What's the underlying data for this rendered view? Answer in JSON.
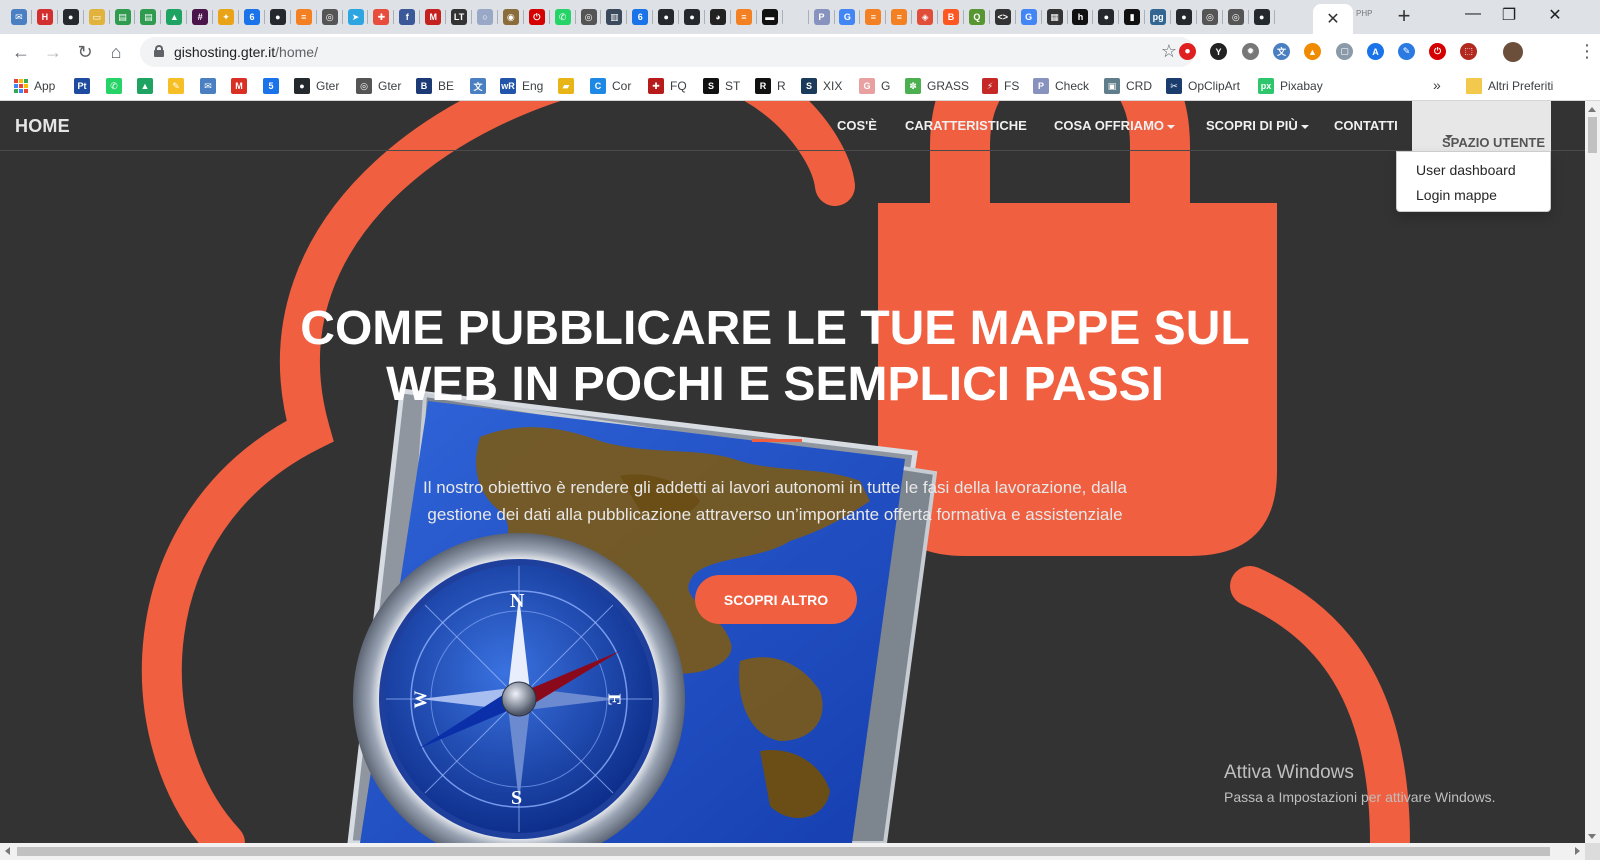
{
  "browser": {
    "url_host": "gishosting.gter.it",
    "url_path": "/home/",
    "tab_close": "✕",
    "new_tab": "+",
    "tab_after_text": "PHP",
    "window_controls": {
      "minimize": "—",
      "restore": "❐",
      "close": "✕"
    },
    "nav_icons": {
      "back": "←",
      "forward": "→",
      "reload": "↻",
      "home": "⌂",
      "star": "☆",
      "menu": "⋮"
    },
    "tab_favicons": [
      {
        "icon": "mail-icon",
        "color": "#4a7fc1",
        "glyph": "✉"
      },
      {
        "icon": "h-icon",
        "color": "#d32f2f",
        "glyph": "H"
      },
      {
        "icon": "github-icon",
        "color": "#24292e",
        "glyph": "●"
      },
      {
        "icon": "folder-icon",
        "color": "#e2b33c",
        "glyph": "▭"
      },
      {
        "icon": "sheet-icon",
        "color": "#2e9b4f",
        "glyph": "▤"
      },
      {
        "icon": "sheet-icon",
        "color": "#2e9b4f",
        "glyph": "▤"
      },
      {
        "icon": "drive-icon",
        "color": "#1ea362",
        "glyph": "▲"
      },
      {
        "icon": "slack-icon",
        "color": "#4a154b",
        "glyph": "#"
      },
      {
        "icon": "pinwheel-icon",
        "color": "#e8a317",
        "glyph": "✦"
      },
      {
        "icon": "calendar-icon",
        "color": "#1a73e8",
        "glyph": "6"
      },
      {
        "icon": "github-icon",
        "color": "#24292e",
        "glyph": "●"
      },
      {
        "icon": "stackoverflow-icon",
        "color": "#f48024",
        "glyph": "≡"
      },
      {
        "icon": "globe-icon",
        "color": "#555555",
        "glyph": "◎"
      },
      {
        "icon": "telegram-icon",
        "color": "#2ca5e0",
        "glyph": "➤"
      },
      {
        "icon": "puzzle-icon",
        "color": "#e74c3c",
        "glyph": "✚"
      },
      {
        "icon": "facebook-icon",
        "color": "#3b5998",
        "glyph": "f"
      },
      {
        "icon": "m-icon",
        "color": "#c5221f",
        "glyph": "M"
      },
      {
        "icon": "lt-icon",
        "color": "#333333",
        "glyph": "LT"
      },
      {
        "icon": "circle-icon",
        "color": "#9aa8c8",
        "glyph": "○"
      },
      {
        "icon": "eye-icon",
        "color": "#8a6d3b",
        "glyph": "◉"
      },
      {
        "icon": "power-icon",
        "color": "#d50000",
        "glyph": "⏻"
      },
      {
        "icon": "whatsapp-icon",
        "color": "#25d366",
        "glyph": "✆"
      },
      {
        "icon": "globe-icon",
        "color": "#555555",
        "glyph": "◎"
      },
      {
        "icon": "book-icon",
        "color": "#3a4a5c",
        "glyph": "▥"
      },
      {
        "icon": "calendar-icon",
        "color": "#1a73e8",
        "glyph": "6"
      },
      {
        "icon": "github-icon",
        "color": "#24292e",
        "glyph": "●"
      },
      {
        "icon": "github-icon",
        "color": "#24292e",
        "glyph": "●"
      },
      {
        "icon": "camera-icon",
        "color": "#222222",
        "glyph": "◕"
      },
      {
        "icon": "stackoverflow-icon",
        "color": "#f48024",
        "glyph": "≡"
      },
      {
        "icon": "monitor-icon",
        "color": "#111111",
        "glyph": "▬"
      },
      {
        "icon": "blank-icon",
        "color": "#dee1e6",
        "glyph": ""
      },
      {
        "icon": "php-icon",
        "color": "#8892bf",
        "glyph": "P"
      },
      {
        "icon": "google-icon",
        "color": "#4285f4",
        "glyph": "G"
      },
      {
        "icon": "stackoverflow-icon",
        "color": "#f48024",
        "glyph": "≡"
      },
      {
        "icon": "stackoverflow-icon",
        "color": "#f48024",
        "glyph": "≡"
      },
      {
        "icon": "paint-icon",
        "color": "#e04e39",
        "glyph": "◈"
      },
      {
        "icon": "blogger-icon",
        "color": "#ff5722",
        "glyph": "B"
      },
      {
        "icon": "qgis-icon",
        "color": "#589632",
        "glyph": "Q"
      },
      {
        "icon": "code-icon",
        "color": "#333333",
        "glyph": "<>"
      },
      {
        "icon": "google-icon",
        "color": "#4285f4",
        "glyph": "G"
      },
      {
        "icon": "barcode-icon",
        "color": "#333333",
        "glyph": "▦"
      },
      {
        "icon": "html-icon",
        "color": "#111111",
        "glyph": "h"
      },
      {
        "icon": "github-icon",
        "color": "#24292e",
        "glyph": "●"
      },
      {
        "icon": "bars-icon",
        "color": "#111111",
        "glyph": "▮"
      },
      {
        "icon": "pg-icon",
        "color": "#336791",
        "glyph": "pg"
      },
      {
        "icon": "github-icon",
        "color": "#24292e",
        "glyph": "●"
      },
      {
        "icon": "globe-icon",
        "color": "#555555",
        "glyph": "◎"
      },
      {
        "icon": "globe-icon",
        "color": "#555555",
        "glyph": "◎"
      },
      {
        "icon": "github-icon",
        "color": "#24292e",
        "glyph": "●"
      }
    ],
    "extensions": [
      {
        "icon": "stop-icon",
        "color": "#e02020",
        "glyph": "⏺"
      },
      {
        "icon": "y-icon",
        "color": "#222222",
        "glyph": "Y"
      },
      {
        "icon": "bug-icon",
        "color": "#777777",
        "glyph": "✹"
      },
      {
        "icon": "translate-icon",
        "color": "#4a7fc1",
        "glyph": "文"
      },
      {
        "icon": "vlc-icon",
        "color": "#f08a00",
        "glyph": "▲"
      },
      {
        "icon": "chat-icon",
        "color": "#8a9aa8",
        "glyph": "▢"
      },
      {
        "icon": "a-icon",
        "color": "#1a73e8",
        "glyph": "A"
      },
      {
        "icon": "feather-icon",
        "color": "#2a7ae2",
        "glyph": "✎"
      },
      {
        "icon": "power-icon",
        "color": "#d50000",
        "glyph": "⏻"
      },
      {
        "icon": "pdf-icon",
        "color": "#b22a1f",
        "glyph": "⬚"
      },
      {
        "icon": "avatar-icon",
        "color": "#6b4f3a",
        "glyph": ""
      }
    ]
  },
  "bookmarks": [
    {
      "icon": "apps-icon",
      "color": "#4285f4",
      "glyph": "",
      "label": "App"
    },
    {
      "icon": "pt-icon",
      "color": "#1e4ba0",
      "glyph": "Pt",
      "label": ""
    },
    {
      "icon": "whatsapp-icon",
      "color": "#25d366",
      "glyph": "✆",
      "label": ""
    },
    {
      "icon": "drive-icon",
      "color": "#1ea362",
      "glyph": "▲",
      "label": ""
    },
    {
      "icon": "keep-icon",
      "color": "#f6bf26",
      "glyph": "✎",
      "label": ""
    },
    {
      "icon": "mail-icon",
      "color": "#4a7fc1",
      "glyph": "✉",
      "label": ""
    },
    {
      "icon": "gmail-icon",
      "color": "#d93025",
      "glyph": "M",
      "label": ""
    },
    {
      "icon": "calendar-icon",
      "color": "#1a73e8",
      "glyph": "5",
      "label": ""
    },
    {
      "icon": "github-icon",
      "color": "#24292e",
      "glyph": "●",
      "label": "Gter"
    },
    {
      "icon": "globe-icon",
      "color": "#555555",
      "glyph": "◎",
      "label": "Gter"
    },
    {
      "icon": "be-icon",
      "color": "#1c3a75",
      "glyph": "B",
      "label": "BE"
    },
    {
      "icon": "translate-icon",
      "color": "#4a7fc1",
      "glyph": "文",
      "label": ""
    },
    {
      "icon": "wr-icon",
      "color": "#2255aa",
      "glyph": "wR",
      "label": "Eng"
    },
    {
      "icon": "flag-icon",
      "color": "#e8b516",
      "glyph": "▰",
      "label": ""
    },
    {
      "icon": "c-icon",
      "color": "#1e88e5",
      "glyph": "C",
      "label": "Cor"
    },
    {
      "icon": "fq-icon",
      "color": "#b71c1c",
      "glyph": "✚",
      "label": "FQ"
    },
    {
      "icon": "st-icon",
      "color": "#111111",
      "glyph": "S",
      "label": "ST"
    },
    {
      "icon": "r-icon",
      "color": "#111111",
      "glyph": "R",
      "label": "R"
    },
    {
      "icon": "xix-icon",
      "color": "#1b3b5a",
      "glyph": "S",
      "label": "XIX"
    },
    {
      "icon": "g-icon",
      "color": "#e8a0a0",
      "glyph": "G",
      "label": "G"
    },
    {
      "icon": "grass-icon",
      "color": "#4caf50",
      "glyph": "✽",
      "label": "GRASS"
    },
    {
      "icon": "fs-icon",
      "color": "#c62828",
      "glyph": "⚡",
      "label": "FS"
    },
    {
      "icon": "php-icon",
      "color": "#8892bf",
      "glyph": "P",
      "label": "Check"
    },
    {
      "icon": "crd-icon",
      "color": "#607d8b",
      "glyph": "▣",
      "label": "CRD"
    },
    {
      "icon": "scissors-icon",
      "color": "#1a3d6d",
      "glyph": "✂",
      "label": "OpClipArt"
    },
    {
      "icon": "pixabay-icon",
      "color": "#2ec66d",
      "glyph": "px",
      "label": "Pixabay"
    }
  ],
  "bookmarks_more": "»",
  "other_bookmarks": {
    "icon": "folder-icon",
    "color": "#f2c94c",
    "label": "Altri Preferiti"
  },
  "site": {
    "brand": "HOME",
    "nav": [
      {
        "label": "COS'È",
        "caret": false
      },
      {
        "label": "CARATTERISTICHE",
        "caret": false
      },
      {
        "label": "COSA OFFRIAMO",
        "caret": true
      },
      {
        "label": "SCOPRI DI PIÙ",
        "caret": true
      },
      {
        "label": "CONTATTI",
        "caret": false
      }
    ],
    "user_menu": {
      "label": "SPAZIO UTENTE",
      "items": [
        "User dashboard",
        "Login mappe"
      ]
    },
    "hero": {
      "title_line1": "COME PUBBLICARE LE TUE MAPPE SUL",
      "title_line2": "WEB IN POCHI E SEMPLICI PASSI",
      "subtitle_line1": "Il nostro obiettivo è rendere gli addetti ai lavori autonomi in tutte le fasi della lavorazione, dalla",
      "subtitle_line2": "gestione dei dati alla pubblicazione attraverso un’importante offerta formativa e assistenziale",
      "button": "SCOPRI ALTRO"
    },
    "compass_letters": {
      "n": "N",
      "s": "S",
      "e": "E",
      "w": "W"
    },
    "colors": {
      "accent": "#f05f40",
      "background": "#333333"
    }
  },
  "os_watermark": {
    "title": "Attiva Windows",
    "subtitle": "Passa a Impostazioni per attivare Windows."
  }
}
